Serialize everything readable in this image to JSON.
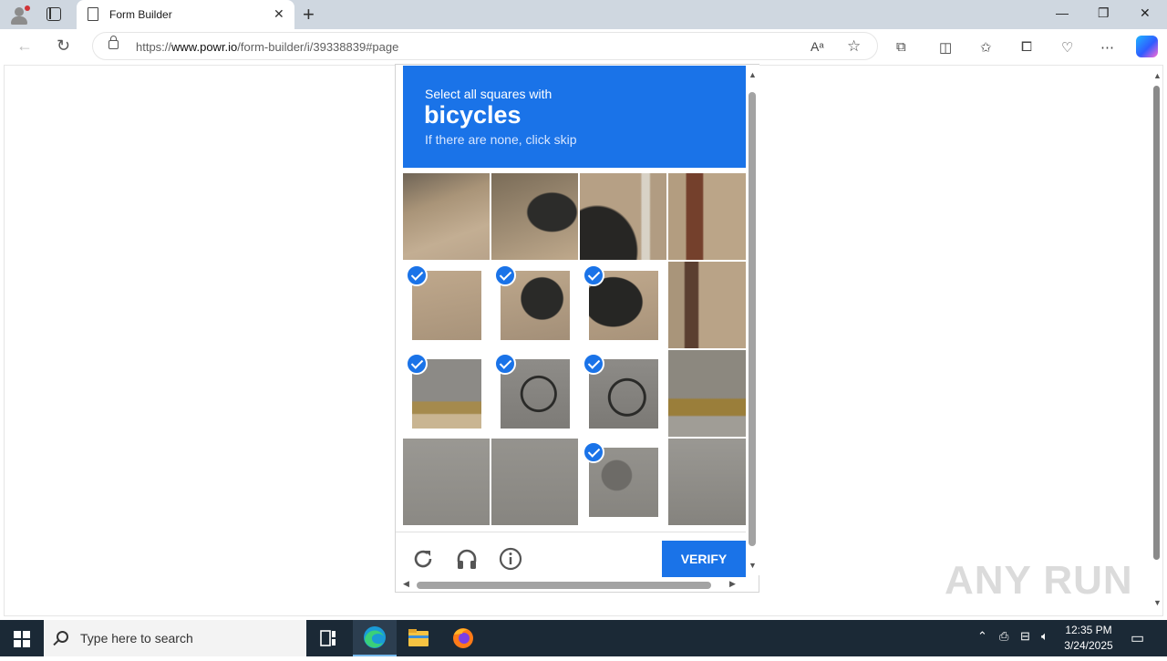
{
  "browser": {
    "tab_title": "Form Builder",
    "tab_close": "✕",
    "new_tab": "+",
    "url_prefix": "https://",
    "url_host": "www.powr.io",
    "url_path": "/form-builder/i/39338839#page",
    "window_controls": {
      "minimize": "—",
      "restore": "❐",
      "close": "✕"
    }
  },
  "captcha": {
    "instruction_line1": "Select all squares with",
    "target": "bicycles",
    "instruction_line3": "If there are none, click skip",
    "verify_label": "VERIFY",
    "header_color": "#1a73e8",
    "grid": [
      [
        false,
        false,
        false,
        false
      ],
      [
        true,
        true,
        true,
        false
      ],
      [
        true,
        true,
        true,
        false
      ],
      [
        false,
        false,
        true,
        false
      ]
    ],
    "footer_icons": [
      "reload-icon",
      "audio-headphones-icon",
      "info-icon"
    ]
  },
  "watermark": "ANY RUN",
  "taskbar": {
    "search_placeholder": "Type here to search",
    "time": "12:35 PM",
    "date": "3/24/2025",
    "apps": [
      "task-view-icon",
      "edge-icon",
      "file-explorer-icon",
      "firefox-icon"
    ]
  }
}
